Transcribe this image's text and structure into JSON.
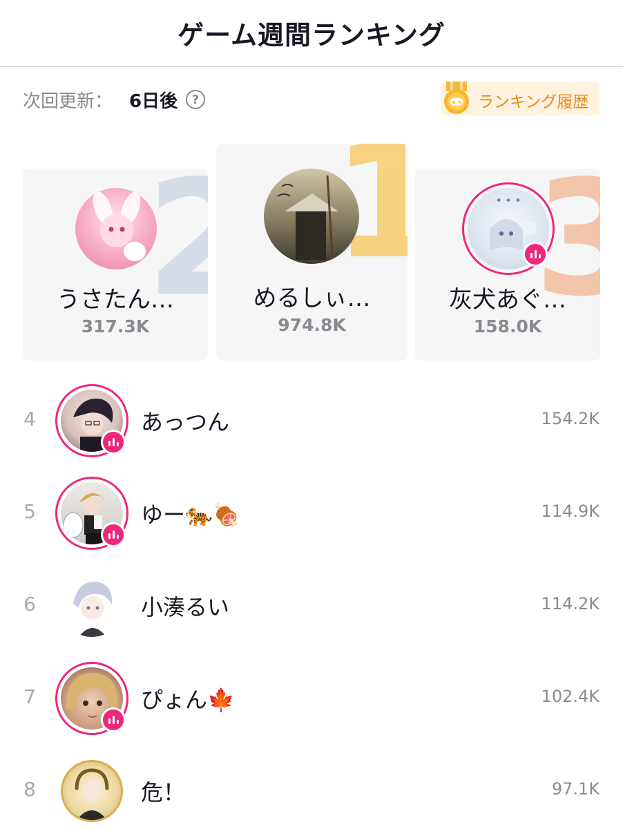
{
  "header": {
    "title": "ゲーム週間ランキング"
  },
  "info": {
    "next_update_label": "次回更新：",
    "next_update_value": "6日後",
    "help_icon": "question-circle-icon",
    "history_label": "ランキング履歴",
    "history_icon": "game-controller-medal-icon"
  },
  "colors": {
    "live_accent": "#f0267a",
    "history_text": "#e88a1a",
    "history_bg": "#fff2df",
    "rank1": "#f5c55a",
    "rank2": "#c9d3e0",
    "rank3": "#f0b898"
  },
  "podium": [
    {
      "rank": "1",
      "name": "めるしぃ…",
      "score": "974.8K",
      "live": false
    },
    {
      "rank": "2",
      "name": "うさたん…",
      "score": "317.3K",
      "live": false
    },
    {
      "rank": "3",
      "name": "灰犬あぐ…",
      "score": "158.0K",
      "live": true
    }
  ],
  "list": [
    {
      "rank": "4",
      "name": "あっつん",
      "score": "154.2K",
      "live": true
    },
    {
      "rank": "5",
      "name": "ゆー🐅🍖",
      "score": "114.9K",
      "live": true
    },
    {
      "rank": "6",
      "name": "小湊るい",
      "score": "114.2K",
      "live": false
    },
    {
      "rank": "7",
      "name": "ぴょん🍁",
      "score": "102.4K",
      "live": true
    },
    {
      "rank": "8",
      "name": "危！",
      "score": "97.1K",
      "live": false
    }
  ]
}
